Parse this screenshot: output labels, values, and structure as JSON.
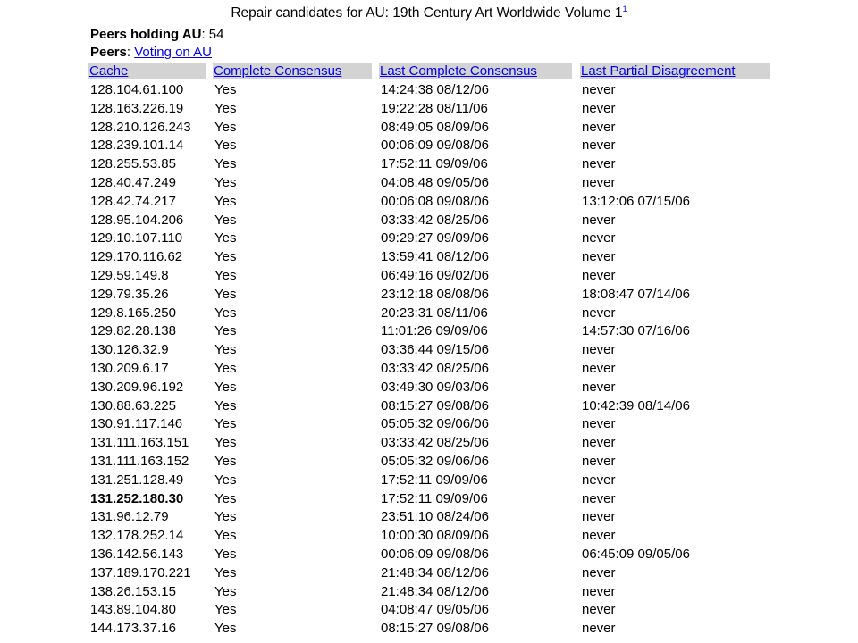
{
  "page": {
    "title": "Repair candidates for AU: 19th Century Art Worldwide Volume 1",
    "footnote": "1",
    "peers_holding_label": "Peers holding AU",
    "peers_holding_value": ": 54",
    "peers_label": "Peers",
    "peers_link": "Voting on AU"
  },
  "table": {
    "headers": [
      "Cache",
      "Complete Consensus",
      "Last Complete Consensus",
      "Last Partial Disagreement"
    ],
    "rows": [
      {
        "cache": "128.104.61.100",
        "consensus": "Yes",
        "last_complete": "14:24:38 08/12/06",
        "last_partial": "never"
      },
      {
        "cache": "128.163.226.19",
        "consensus": "Yes",
        "last_complete": "19:22:28 08/11/06",
        "last_partial": "never"
      },
      {
        "cache": "128.210.126.243",
        "consensus": "Yes",
        "last_complete": "08:49:05 08/09/06",
        "last_partial": "never"
      },
      {
        "cache": "128.239.101.14",
        "consensus": "Yes",
        "last_complete": "00:06:09 09/08/06",
        "last_partial": "never"
      },
      {
        "cache": "128.255.53.85",
        "consensus": "Yes",
        "last_complete": "17:52:11 09/09/06",
        "last_partial": "never"
      },
      {
        "cache": "128.40.47.249",
        "consensus": "Yes",
        "last_complete": "04:08:48 09/05/06",
        "last_partial": "never"
      },
      {
        "cache": "128.42.74.217",
        "consensus": "Yes",
        "last_complete": "00:06:08 09/08/06",
        "last_partial": "13:12:06 07/15/06"
      },
      {
        "cache": "128.95.104.206",
        "consensus": "Yes",
        "last_complete": "03:33:42 08/25/06",
        "last_partial": "never"
      },
      {
        "cache": "129.10.107.110",
        "consensus": "Yes",
        "last_complete": "09:29:27 09/09/06",
        "last_partial": "never"
      },
      {
        "cache": "129.170.116.62",
        "consensus": "Yes",
        "last_complete": "13:59:41 08/12/06",
        "last_partial": "never"
      },
      {
        "cache": "129.59.149.8",
        "consensus": "Yes",
        "last_complete": "06:49:16 09/02/06",
        "last_partial": "never"
      },
      {
        "cache": "129.79.35.26",
        "consensus": "Yes",
        "last_complete": "23:12:18 08/08/06",
        "last_partial": "18:08:47 07/14/06"
      },
      {
        "cache": "129.8.165.250",
        "consensus": "Yes",
        "last_complete": "20:23:31 08/11/06",
        "last_partial": "never"
      },
      {
        "cache": "129.82.28.138",
        "consensus": "Yes",
        "last_complete": "11:01:26 09/09/06",
        "last_partial": "14:57:30 07/16/06"
      },
      {
        "cache": "130.126.32.9",
        "consensus": "Yes",
        "last_complete": "03:36:44 09/15/06",
        "last_partial": "never"
      },
      {
        "cache": "130.209.6.17",
        "consensus": "Yes",
        "last_complete": "03:33:42 08/25/06",
        "last_partial": "never"
      },
      {
        "cache": "130.209.96.192",
        "consensus": "Yes",
        "last_complete": "03:49:30 09/03/06",
        "last_partial": "never"
      },
      {
        "cache": "130.88.63.225",
        "consensus": "Yes",
        "last_complete": "08:15:27 09/08/06",
        "last_partial": "10:42:39 08/14/06"
      },
      {
        "cache": "130.91.117.146",
        "consensus": "Yes",
        "last_complete": "05:05:32 09/06/06",
        "last_partial": "never"
      },
      {
        "cache": "131.111.163.151",
        "consensus": "Yes",
        "last_complete": "03:33:42 08/25/06",
        "last_partial": "never"
      },
      {
        "cache": "131.111.163.152",
        "consensus": "Yes",
        "last_complete": "05:05:32 09/06/06",
        "last_partial": "never"
      },
      {
        "cache": "131.251.128.49",
        "consensus": "Yes",
        "last_complete": "17:52:11 09/09/06",
        "last_partial": "never"
      },
      {
        "cache": "131.252.180.30",
        "consensus": "Yes",
        "last_complete": "17:52:11 09/09/06",
        "last_partial": "never",
        "bold": true
      },
      {
        "cache": "131.96.12.79",
        "consensus": "Yes",
        "last_complete": "23:51:10 08/24/06",
        "last_partial": "never"
      },
      {
        "cache": "132.178.252.14",
        "consensus": "Yes",
        "last_complete": "10:00:30 08/09/06",
        "last_partial": "never"
      },
      {
        "cache": "136.142.56.143",
        "consensus": "Yes",
        "last_complete": "00:06:09 09/08/06",
        "last_partial": "06:45:09 09/05/06"
      },
      {
        "cache": "137.189.170.221",
        "consensus": "Yes",
        "last_complete": "21:48:34 08/12/06",
        "last_partial": "never"
      },
      {
        "cache": "138.26.153.15",
        "consensus": "Yes",
        "last_complete": "21:48:34 08/12/06",
        "last_partial": "never"
      },
      {
        "cache": "143.89.104.80",
        "consensus": "Yes",
        "last_complete": "04:08:47 09/05/06",
        "last_partial": "never"
      },
      {
        "cache": "144.173.37.16",
        "consensus": "Yes",
        "last_complete": "08:15:27 09/08/06",
        "last_partial": "never"
      }
    ]
  }
}
